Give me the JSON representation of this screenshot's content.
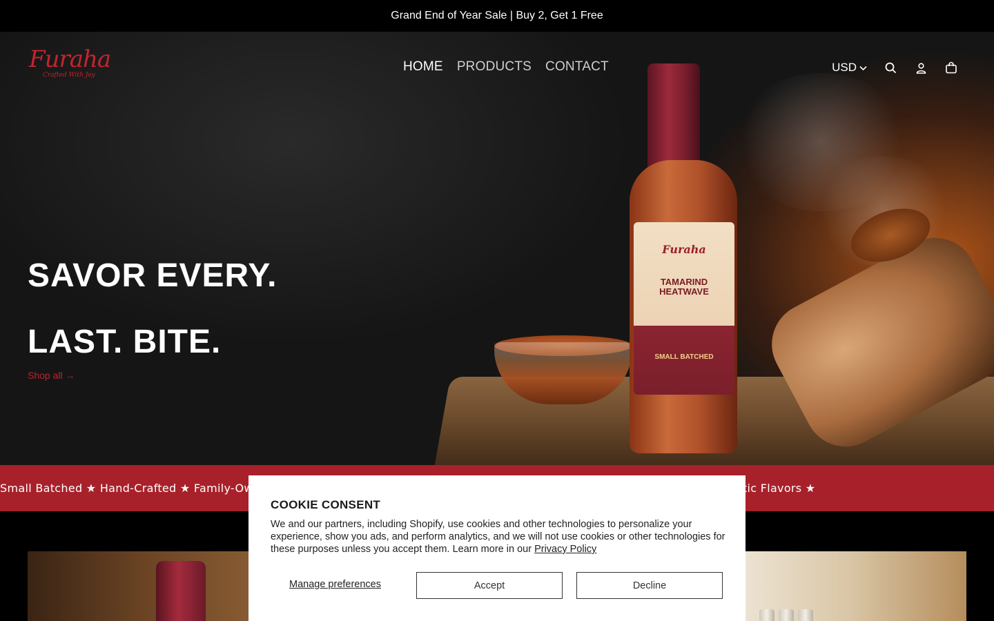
{
  "announcement": {
    "text": "Grand End of Year Sale | Buy 2, Get 1 Free"
  },
  "brand": {
    "name": "Furaha",
    "tagline": "Crafted With Joy",
    "accent_color": "#c4242d"
  },
  "nav": {
    "items": [
      {
        "label": "HOME",
        "active": true
      },
      {
        "label": "PRODUCTS",
        "active": false
      },
      {
        "label": "CONTACT",
        "active": false
      }
    ]
  },
  "tools": {
    "currency": "USD",
    "icons": [
      "chevron-down-icon",
      "search-icon",
      "account-icon",
      "cart-icon"
    ]
  },
  "hero": {
    "title_line1": "SAVOR EVERY.",
    "title_line2": "LAST. BITE.",
    "cta": "Shop all →",
    "bottle_label": {
      "brand": "Furaha",
      "name_line1": "TAMARIND",
      "name_line2": "HEATWAVE",
      "batch": "SMALL BATCHED"
    }
  },
  "marquee": {
    "text": "Small Batched ★ Hand-Crafted ★ Family-Owned ★ Authentic Flavors ★ Small Batched ★ Hand-Crafted ★ Family-Owned ★ Authentic Flavors ★",
    "background": "#a8212a"
  },
  "cookie": {
    "title": "COOKIE CONSENT",
    "body": "We and our partners, including Shopify, use cookies and other technologies to personalize your experience, show you ads, and perform analytics, and we will not use cookies or other technologies for these purposes unless you accept them. Learn more in our",
    "privacy_link": "Privacy Policy",
    "manage_label": "Manage preferences",
    "accept_label": "Accept",
    "decline_label": "Decline"
  }
}
